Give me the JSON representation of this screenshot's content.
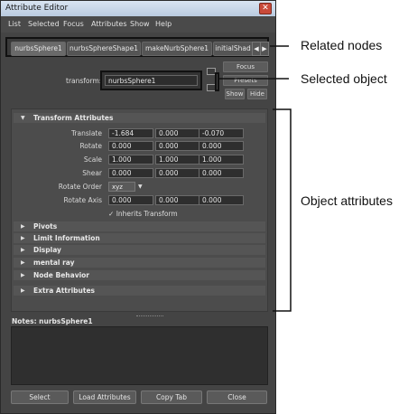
{
  "window": {
    "title": "Attribute Editor",
    "close_glyph": "✕"
  },
  "menu": [
    "List",
    "Selected",
    "Focus",
    "Attributes",
    "Show",
    "Help"
  ],
  "tabs": [
    "nurbsSphere1",
    "nurbsSphereShape1",
    "makeNurbSphere1",
    "initialShad"
  ],
  "tab_arrows": {
    "left": "◀",
    "right": "▶"
  },
  "node": {
    "label": "transform:",
    "value": "nurbsSphere1"
  },
  "side_buttons": {
    "focus": "Focus",
    "presets": "Presets",
    "show": "Show",
    "hide": "Hide"
  },
  "transform_section": {
    "title": "Transform Attributes",
    "rows": [
      {
        "label": "Translate",
        "values": [
          "-1.684",
          "0.000",
          "-0.070"
        ]
      },
      {
        "label": "Rotate",
        "values": [
          "0.000",
          "0.000",
          "0.000"
        ]
      },
      {
        "label": "Scale",
        "values": [
          "1.000",
          "1.000",
          "1.000"
        ]
      },
      {
        "label": "Shear",
        "values": [
          "0.000",
          "0.000",
          "0.000"
        ]
      }
    ],
    "rotate_order": {
      "label": "Rotate Order",
      "value": "xyz"
    },
    "rotate_axis": {
      "label": "Rotate Axis",
      "values": [
        "0.000",
        "0.000",
        "0.000"
      ]
    },
    "inherits": {
      "label": "Inherits Transform",
      "checked": true
    }
  },
  "collapsed_sections": [
    "Pivots",
    "Limit Information",
    "Display",
    "mental ray",
    "Node Behavior",
    "Extra Attributes"
  ],
  "notes": {
    "label": "Notes:  nurbsSphere1"
  },
  "bottom_buttons": [
    "Select",
    "Load Attributes",
    "Copy Tab",
    "Close"
  ],
  "callouts": {
    "related_nodes": "Related nodes",
    "selected_object": "Selected object",
    "object_attributes": "Object attributes"
  }
}
